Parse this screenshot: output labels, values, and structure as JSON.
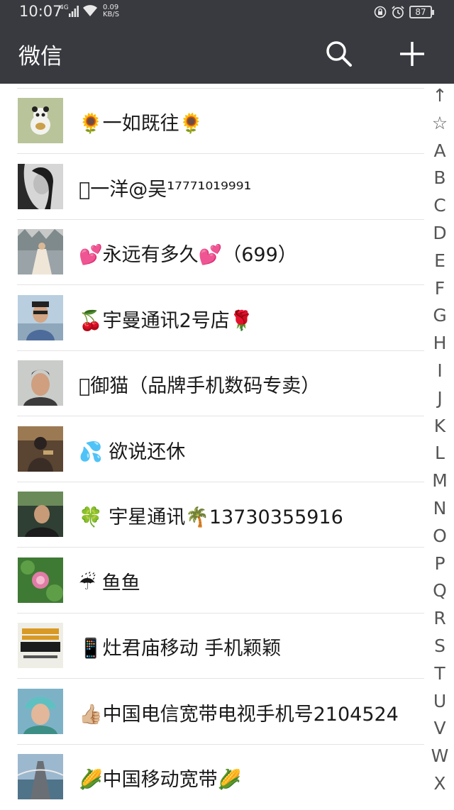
{
  "status_bar": {
    "time": "10:07",
    "network": "4G",
    "speed": "0.09\nKB/S",
    "battery": "87"
  },
  "header": {
    "title": "微信"
  },
  "contacts": [
    {
      "name": "🌻一如既往🌻"
    },
    {
      "name": "􀀀一洋@吴¹⁷⁷⁷¹⁰¹⁹⁹⁹¹"
    },
    {
      "name": "💕永远有多久💕（699）"
    },
    {
      "name": "🍒宇曼通讯2号店🌹"
    },
    {
      "name": "􀀀御猫（品牌手机数码专卖）"
    },
    {
      "name": "💦 欲说还休"
    },
    {
      "name": "🍀 宇星通讯🌴13730355916"
    },
    {
      "name": "☔ 鱼鱼"
    },
    {
      "name": "📱灶君庙移动 手机颖颖"
    },
    {
      "name": "👍🏼中国电信宽带电视手机号2104524"
    },
    {
      "name": "🌽中国移动宽带🌽"
    }
  ],
  "index_letters": [
    "↑",
    "☆",
    "A",
    "B",
    "C",
    "D",
    "E",
    "F",
    "G",
    "H",
    "I",
    "J",
    "K",
    "L",
    "M",
    "N",
    "O",
    "P",
    "Q",
    "R",
    "S",
    "T",
    "U",
    "V",
    "W",
    "X"
  ]
}
